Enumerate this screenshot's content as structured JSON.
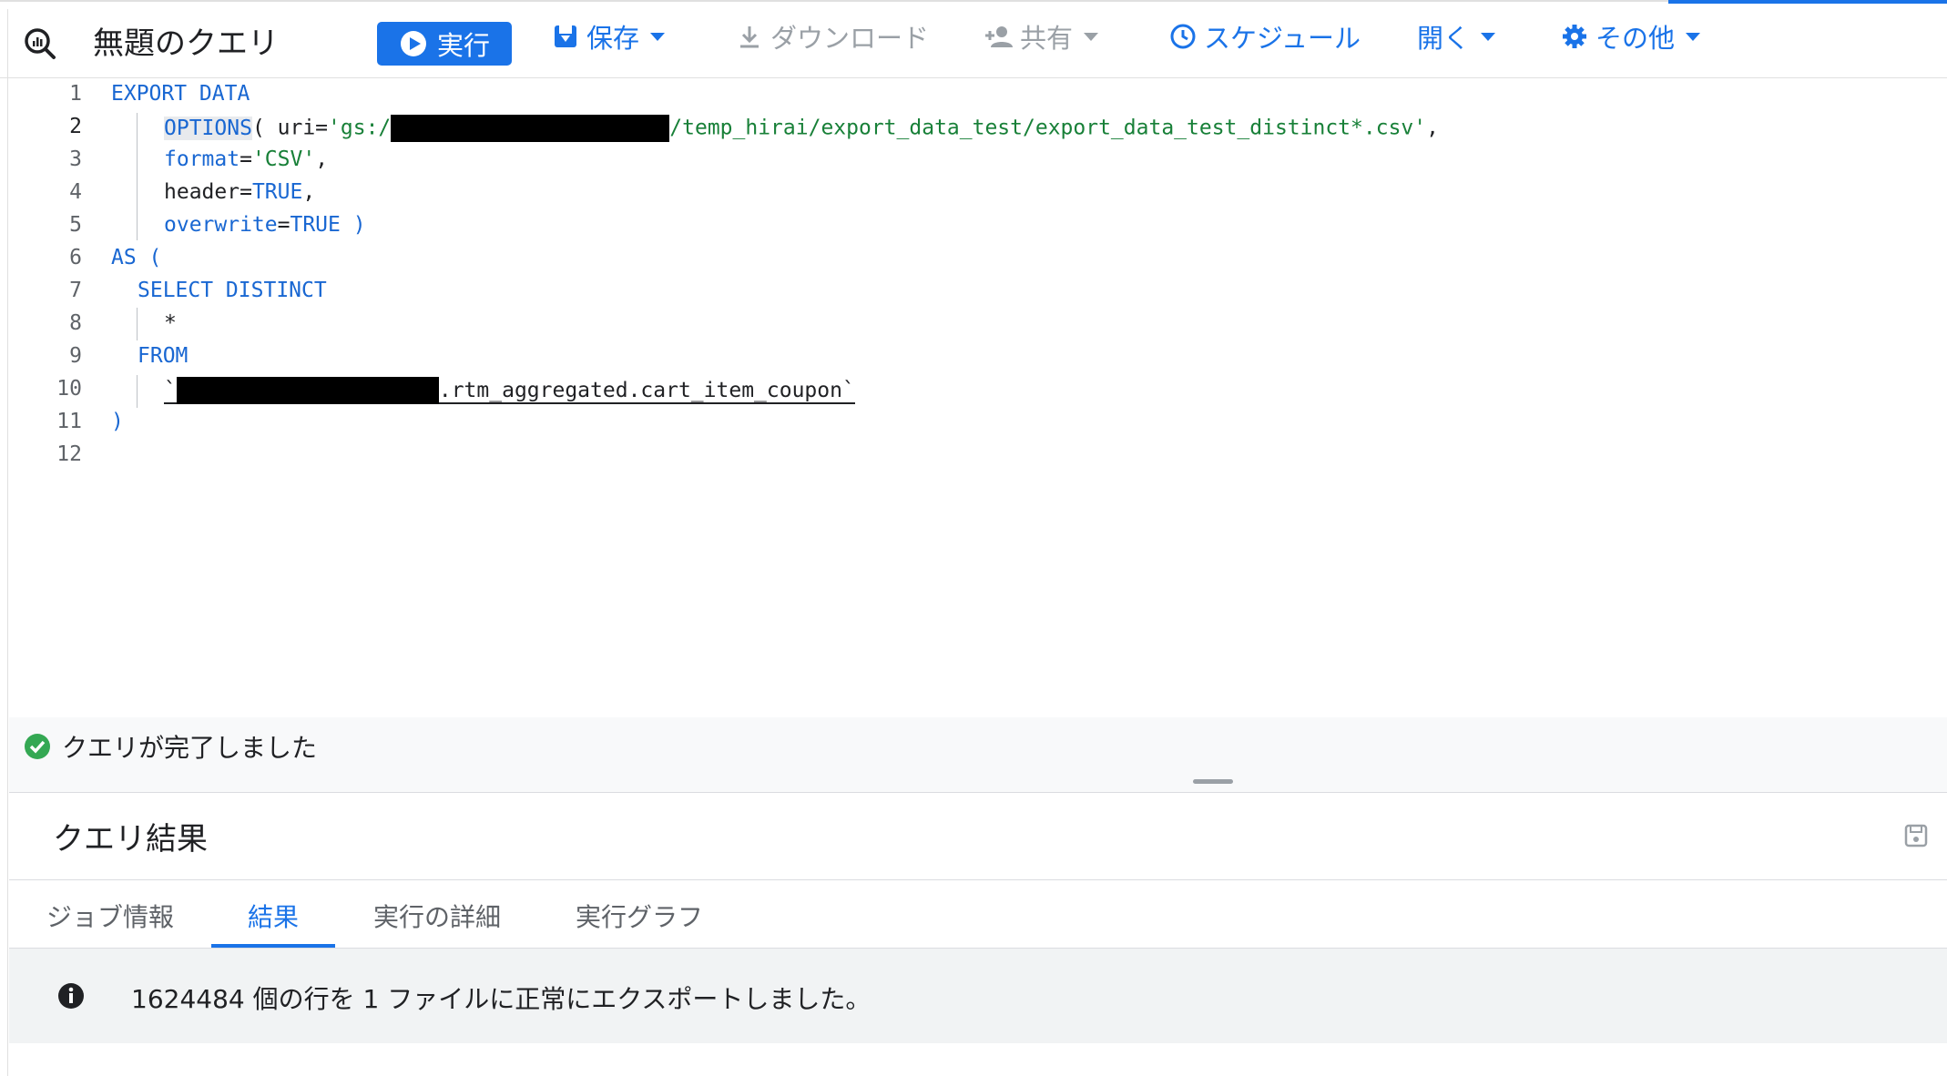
{
  "toolbar": {
    "title": "無題のクエリ",
    "run_label": "実行",
    "save_label": "保存",
    "download_label": "ダウンロード",
    "share_label": "共有",
    "schedule_label": "スケジュール",
    "open_label": "開く",
    "more_label": "その他"
  },
  "editor": {
    "line_numbers": [
      "1",
      "2",
      "3",
      "4",
      "5",
      "6",
      "7",
      "8",
      "9",
      "10",
      "11",
      "12"
    ],
    "active_line": "2",
    "lines": {
      "l1": "EXPORT DATA",
      "l2_kw": "OPTIONS",
      "l2_a": "( uri=",
      "l2_str_a": "'gs:/",
      "l2_str_b": "/temp_hirai/export_data_test/export_data_test_distinct*.csv'",
      "l2_c": ",",
      "l3_kw": "format",
      "l3_eq": "=",
      "l3_str": "'CSV'",
      "l3_c": ",",
      "l4_a": "header=",
      "l4_kw": "TRUE",
      "l4_c": ",",
      "l5_kw": "overwrite",
      "l5_eq": "=",
      "l5_kw2": "TRUE )",
      "l6": "AS (",
      "l7": "SELECT DISTINCT",
      "l8": "*",
      "l9": "FROM",
      "l10_tick": "`",
      "l10_rest": ".rtm_aggregated.cart_item_coupon`",
      "l11": ")"
    }
  },
  "status": {
    "message": "クエリが完了しました"
  },
  "results": {
    "title": "クエリ結果",
    "tabs": [
      {
        "label": "ジョブ情報"
      },
      {
        "label": "結果"
      },
      {
        "label": "実行の詳細"
      },
      {
        "label": "実行グラフ"
      }
    ],
    "active_tab": "結果",
    "info_message": "1624484 個の行を 1 ファイルに正常にエクスポートしました。"
  },
  "colors": {
    "accent": "#1a73e8",
    "keyword": "#1967d2",
    "string": "#188038",
    "success": "#34a853"
  },
  "icons": {
    "query": "query-magnifier-icon",
    "run": "play-circle-icon",
    "save": "save-icon",
    "download": "download-icon",
    "share": "person-add-icon",
    "schedule": "clock-icon",
    "more": "gear-icon",
    "status": "check-circle-icon",
    "info": "info-icon"
  }
}
